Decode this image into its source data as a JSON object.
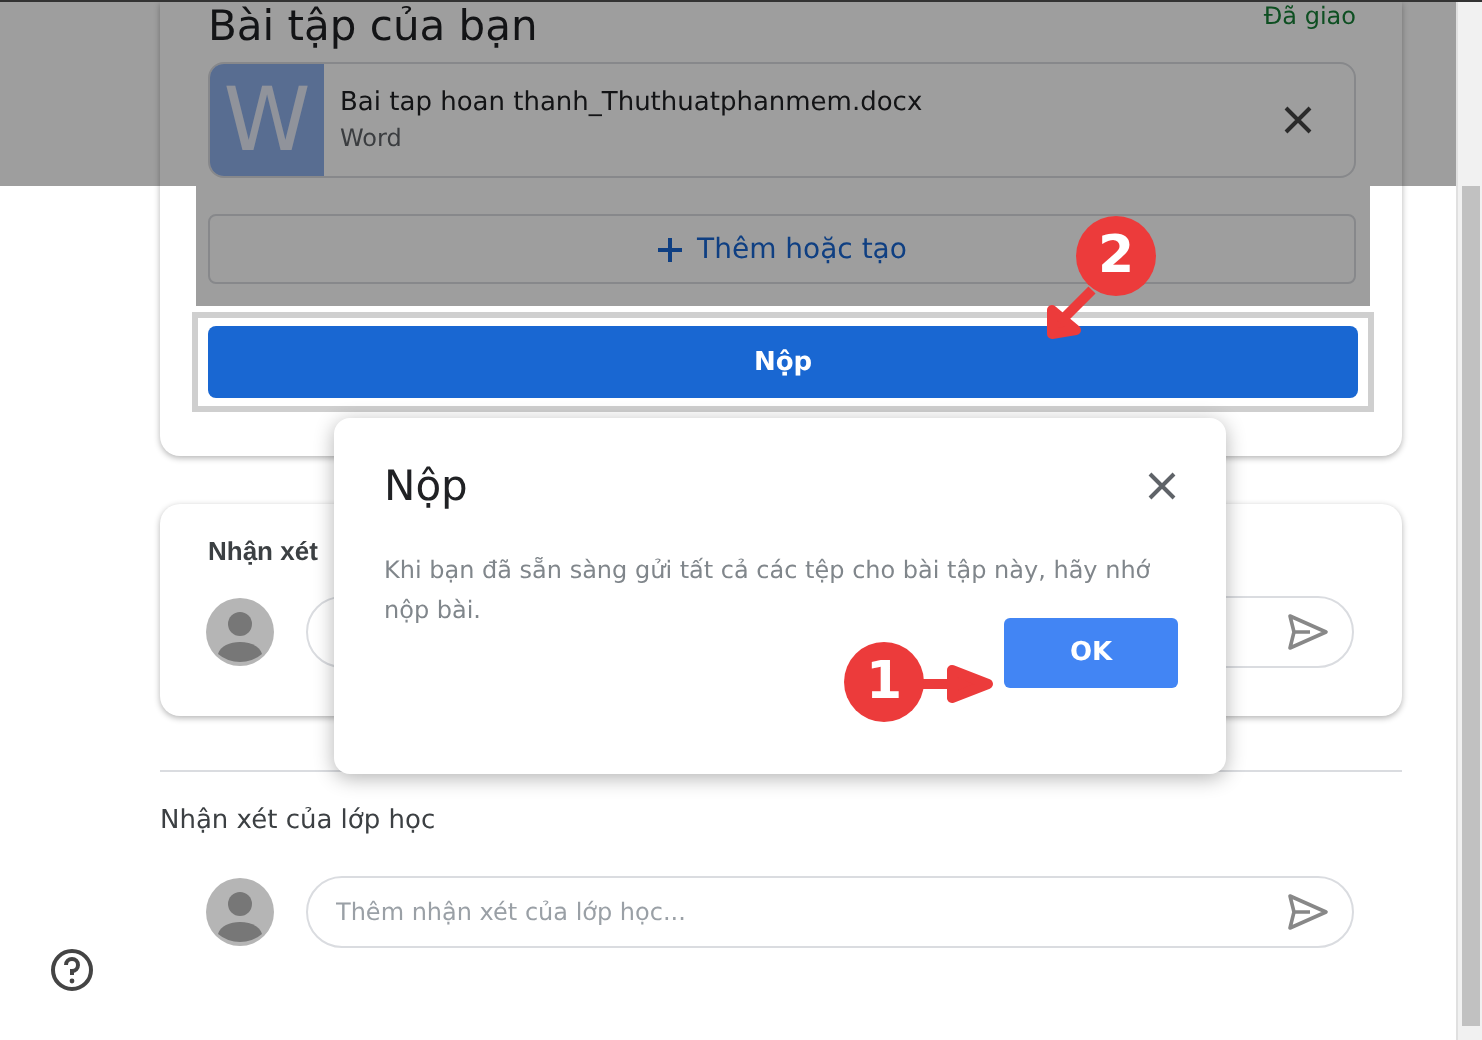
{
  "assignment_card": {
    "title": "Bài tập của bạn",
    "status": "Đã giao",
    "attachment": {
      "icon_letter": "W",
      "name": "Bai tap hoan thanh_Thuthuatphanmem.docx",
      "type": "Word"
    },
    "add_button": "Thêm hoặc tạo",
    "submit_button": "Nộp"
  },
  "private_comments": {
    "title": "Nhận xét"
  },
  "class_comments": {
    "title": "Nhận xét của lớp học",
    "placeholder": "Thêm nhận xét của lớp học..."
  },
  "dialog": {
    "title": "Nộp",
    "message": "Khi bạn đã sẵn sàng gửi tất cả các tệp cho bài tập này, hãy nhớ nộp bài.",
    "button": "OK"
  },
  "annotations": [
    {
      "number": "1"
    },
    {
      "number": "2"
    }
  ]
}
